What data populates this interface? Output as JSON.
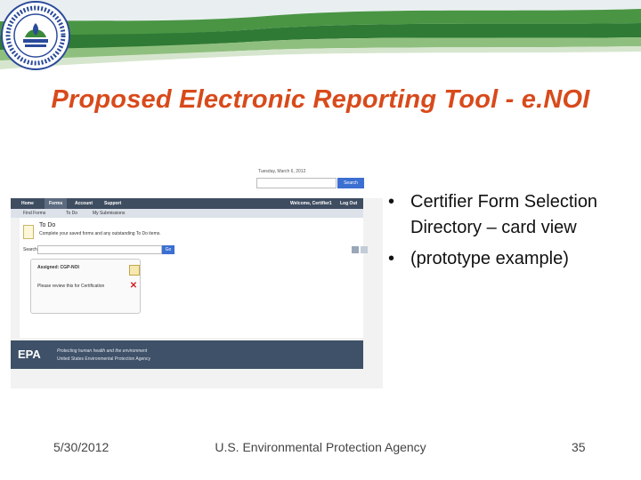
{
  "slide": {
    "title": "Proposed Electronic Reporting Tool - e.NOI",
    "colors": {
      "title": "#d84a1b",
      "band": "#3c8a3a",
      "accent": "#2b4a9a"
    }
  },
  "seal": {
    "icon": "epa-seal-icon",
    "text": "UNITED STATES ENVIRONMENTAL PROTECTION"
  },
  "screenshot": {
    "date": "Tuesday, March 6, 2012",
    "search_button": "Search",
    "nav": [
      "Home",
      "Forms",
      "Account",
      "Support"
    ],
    "welcome": "Welcome, Certifier1",
    "logout": "Log Out",
    "subnav": [
      "Find Forms",
      "To Do",
      "My Submissions"
    ],
    "todo_title": "To Do",
    "todo_desc": "Complete your saved forms and any outstanding To Do items.",
    "filter_label": "Search",
    "go_button": "Go",
    "card_title": "Assigned: CGP-NOI",
    "card_text": "Please review this for Certification",
    "footer_logo": "EPA",
    "footer_line1": "Protecting human health and the environment",
    "footer_line2": "United States Environmental Protection Agency"
  },
  "bullets": [
    "Certifier Form Selection Directory – card view",
    "(prototype example)"
  ],
  "footer": {
    "date": "5/30/2012",
    "agency": "U.S. Environmental Protection Agency",
    "page": "35"
  }
}
